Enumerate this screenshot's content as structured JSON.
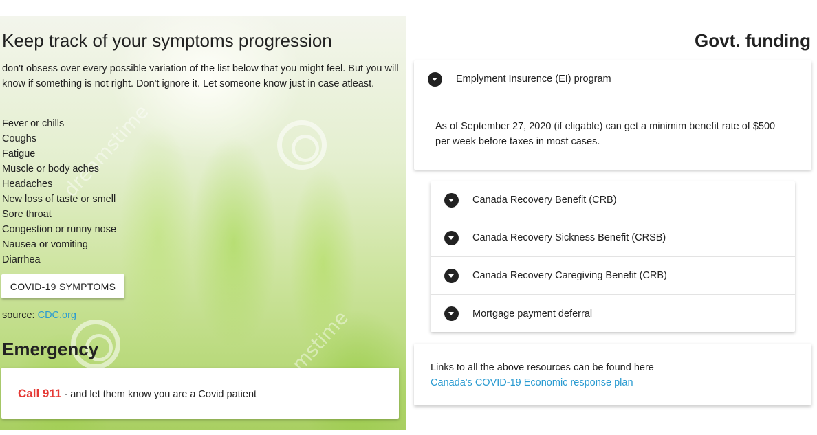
{
  "symptoms_section": {
    "title": "Keep track of your symptoms progression",
    "intro": "don't obsess over every possible variation of the list below that you might feel. But you will know if something is not right. Don't ignore it. Let someone know just in case atleast.",
    "items": [
      "Fever or chills",
      "Coughs",
      "Fatigue",
      "Muscle or body aches",
      "Headaches",
      "New loss of taste or smell",
      "Sore throat",
      "Congestion or runny nose",
      "Nausea or vomiting",
      "Diarrhea"
    ],
    "button_label": "COVID-19 SYMPTOMS",
    "source_label": "source:",
    "source_link": "CDC.org"
  },
  "emergency": {
    "title": "Emergency",
    "call": "Call 911",
    "message": " - and let them know you are a Covid patient"
  },
  "funding": {
    "title": "Govt. funding",
    "expanded": {
      "label": "Emplyment Insurence (EI) program",
      "body": "As of September 27, 2020 (if eligable) can get a minimim benefit rate of $500 per week before taxes in most cases."
    },
    "collapsed": [
      "Canada Recovery Benefit (CRB)",
      "Canada Recovery Sickness Benefit (CRSB)",
      "Canada Recovery Caregiving Benefit (CRB)",
      "Mortgage payment deferral"
    ],
    "links_text": "Links to all the above resources can be found here",
    "links_link": "Canada's COVID-19 Economic response plan"
  },
  "colors": {
    "link": "#2a9bd1",
    "emergency_red": "#e53935",
    "chevron": "#222222"
  }
}
